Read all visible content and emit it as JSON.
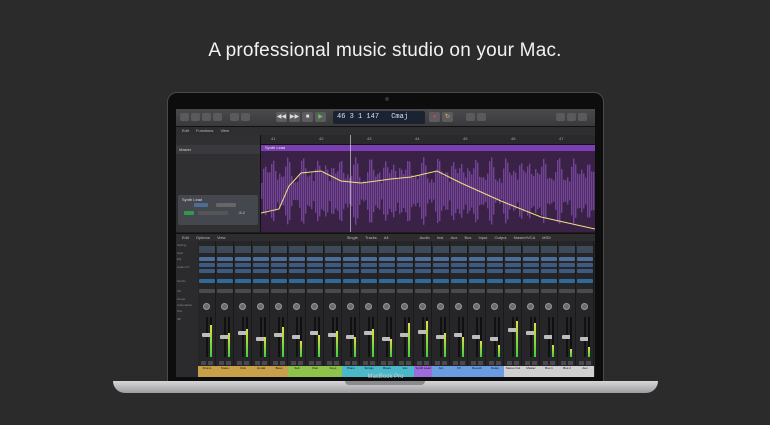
{
  "headline": "A professional music studio on your Mac.",
  "device_label": "MacBook Pro",
  "lcd": {
    "bar": "46",
    "beat": "3",
    "sub": "1",
    "tick": "147",
    "key": "Cmaj"
  },
  "transport": {
    "rewind": "◀◀",
    "forward": "▶▶",
    "stop": "■",
    "play": "▶",
    "record": "●",
    "cycle": "↻"
  },
  "menu": {
    "items": [
      "Edit",
      "Functions",
      "View"
    ]
  },
  "ruler": {
    "ticks": [
      "41",
      "42",
      "43",
      "44",
      "45",
      "46",
      "47"
    ]
  },
  "inspector": {
    "region_label": "Master",
    "track_name": "Synth Lead",
    "volume_db": "-5.2"
  },
  "region": {
    "name": "Synth Lead"
  },
  "mixer_toolbar": {
    "items": [
      "Edit",
      "Options",
      "View",
      "Single",
      "Tracks",
      "All",
      "Audio",
      "Inst",
      "Aux",
      "Bus",
      "Input",
      "Output",
      "Master/VCA",
      "MIDI"
    ]
  },
  "mixer_labels": [
    "Setting",
    "Gain",
    "EQ",
    "Audio FX",
    "Sends",
    "I/O",
    "Group",
    "Automation",
    "Pan",
    "dB"
  ],
  "strips": [
    {
      "name": "Drums",
      "color": "#c8a04a",
      "fader": 0.55,
      "meter": 0.8
    },
    {
      "name": "Snare",
      "color": "#c8a04a",
      "fader": 0.5,
      "meter": 0.6
    },
    {
      "name": "Kick",
      "color": "#c8a04a",
      "fader": 0.6,
      "meter": 0.7
    },
    {
      "name": "Hi-Hat",
      "color": "#c8a04a",
      "fader": 0.45,
      "meter": 0.5
    },
    {
      "name": "Bass",
      "color": "#c8a04a",
      "fader": 0.55,
      "meter": 0.75
    },
    {
      "name": "Sub",
      "color": "#8fc24a",
      "fader": 0.5,
      "meter": 0.4
    },
    {
      "name": "Pad",
      "color": "#8fc24a",
      "fader": 0.6,
      "meter": 0.55
    },
    {
      "name": "Keys",
      "color": "#8fc24a",
      "fader": 0.55,
      "meter": 0.65
    },
    {
      "name": "Piano",
      "color": "#4ab8c8",
      "fader": 0.5,
      "meter": 0.5
    },
    {
      "name": "Strings",
      "color": "#4ab8c8",
      "fader": 0.6,
      "meter": 0.7
    },
    {
      "name": "Brass",
      "color": "#4ab8c8",
      "fader": 0.45,
      "meter": 0.45
    },
    {
      "name": "Vox",
      "color": "#4ab8c8",
      "fader": 0.55,
      "meter": 0.85
    },
    {
      "name": "Synth Lead",
      "color": "#9b6be0",
      "fader": 0.65,
      "meter": 0.9
    },
    {
      "name": "Arp",
      "color": "#6b9be0",
      "fader": 0.5,
      "meter": 0.6
    },
    {
      "name": "FX",
      "color": "#6b9be0",
      "fader": 0.55,
      "meter": 0.5
    },
    {
      "name": "Reverb",
      "color": "#6b9be0",
      "fader": 0.5,
      "meter": 0.4
    },
    {
      "name": "Delay",
      "color": "#6b9be0",
      "fader": 0.45,
      "meter": 0.3
    },
    {
      "name": "Stereo Out",
      "color": "#d0d0d0",
      "fader": 0.7,
      "meter": 0.9
    },
    {
      "name": "Master",
      "color": "#d0d0d0",
      "fader": 0.6,
      "meter": 0.85
    },
    {
      "name": "Bus 1",
      "color": "#d0d0d0",
      "fader": 0.5,
      "meter": 0.3
    },
    {
      "name": "Bus 2",
      "color": "#d0d0d0",
      "fader": 0.5,
      "meter": 0.2
    },
    {
      "name": "Aux",
      "color": "#d0d0d0",
      "fader": 0.45,
      "meter": 0.25
    }
  ]
}
